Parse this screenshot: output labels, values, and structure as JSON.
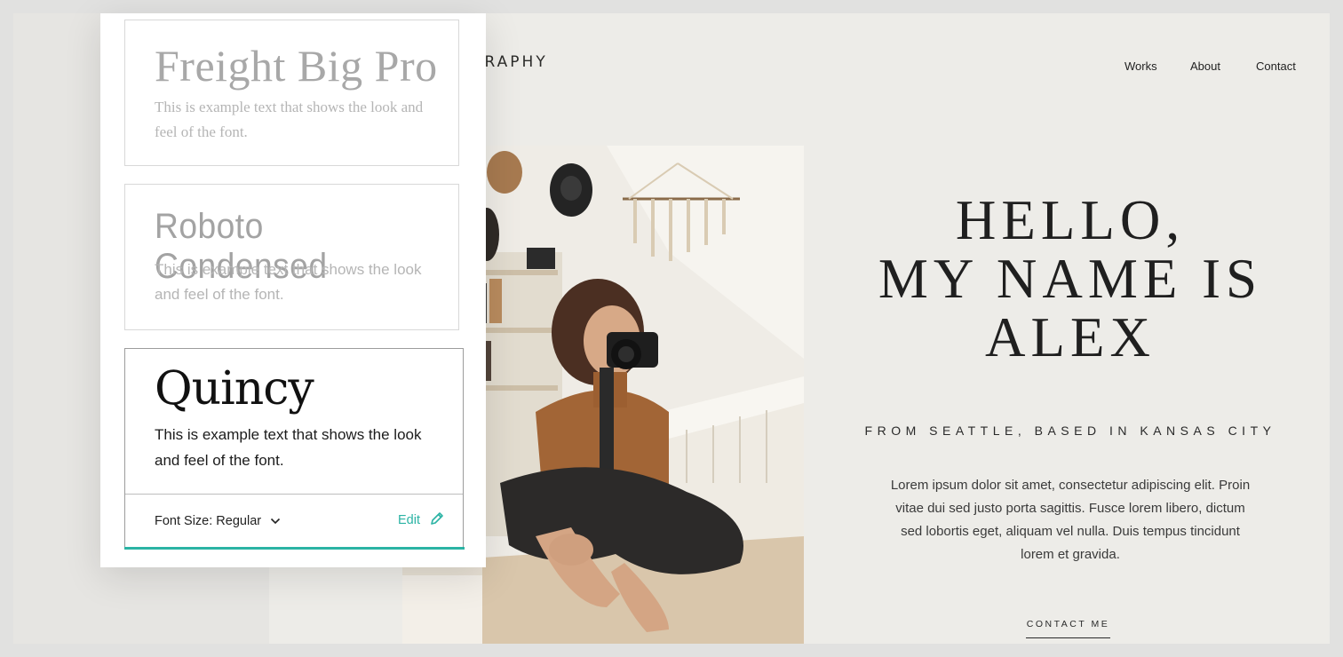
{
  "site": {
    "brand": "OGRAPHY",
    "nav": [
      "Works",
      "About",
      "Contact"
    ]
  },
  "hero": {
    "title_lines": [
      "HELLO,",
      "MY NAME IS",
      "ALEX"
    ],
    "subtitle": "FROM SEATTLE, BASED IN KANSAS CITY",
    "paragraph": "Lorem ipsum dolor sit amet, consectetur adipiscing elit. Proin vitae dui sed justo porta sagittis. Fusce lorem libero, dictum sed lobortis eget, aliquam vel nulla. Duis tempus tincidunt lorem et gravida.",
    "cta": "CONTACT ME"
  },
  "font_panel": {
    "fonts": [
      {
        "name": "Freight Big Pro",
        "sample": "This is example text that shows the look and feel of the font."
      },
      {
        "name": "Roboto Condensed",
        "sample": "This is example text that shows the look and feel of the font."
      },
      {
        "name": "Quincy",
        "sample": "This is example text that shows the look and feel of the font."
      }
    ],
    "font_size_label": "Font Size: Regular",
    "edit_label": "Edit"
  },
  "colors": {
    "accent": "#2bb3a4",
    "page_bg": "#edece8"
  },
  "icons": {
    "dropdown": "chevron-down-icon",
    "edit": "pencil-icon"
  }
}
